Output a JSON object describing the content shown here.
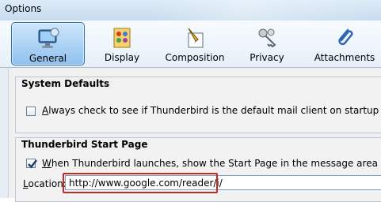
{
  "window": {
    "title": "Options"
  },
  "toolbar": {
    "tabs": [
      {
        "label": "General",
        "icon": "monitor-icon",
        "selected": true
      },
      {
        "label": "Display",
        "icon": "palette-icon",
        "selected": false
      },
      {
        "label": "Composition",
        "icon": "pen-paper-icon",
        "selected": false
      },
      {
        "label": "Privacy",
        "icon": "keys-icon",
        "selected": false
      },
      {
        "label": "Attachments",
        "icon": "paperclip-icon",
        "selected": false
      }
    ]
  },
  "system_defaults": {
    "title": "System Defaults",
    "check_label": "Always check to see if Thunderbird is the default mail client on startup",
    "checked": false
  },
  "start_page": {
    "title": "Thunderbird Start Page",
    "check_label": "When Thunderbird launches, show the Start Page in the message area",
    "checked": true,
    "location_label": "Location:",
    "location_value": "http://www.google.com/reader/i/"
  },
  "colors": {
    "highlight": "#c22a25",
    "selected_tab": "#8fc1ee"
  }
}
